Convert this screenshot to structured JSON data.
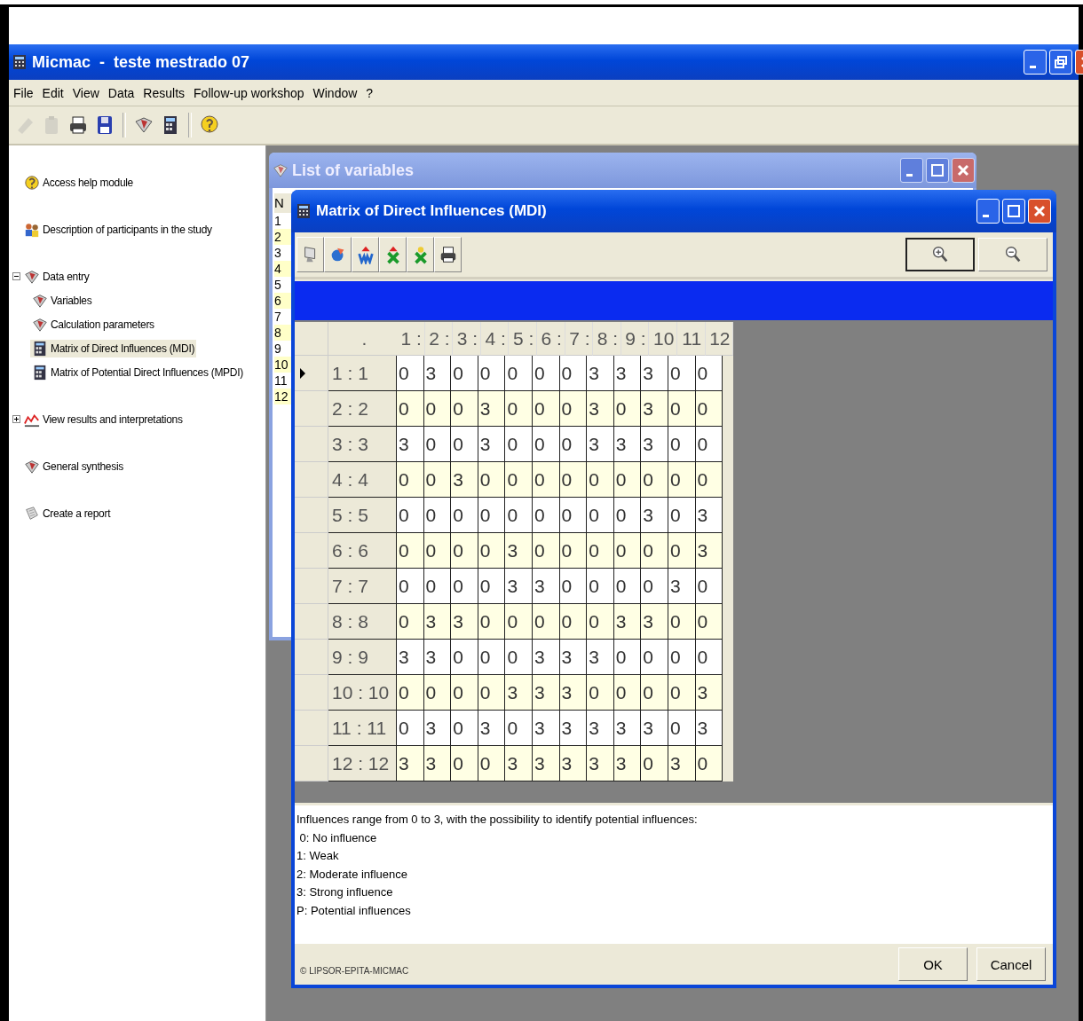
{
  "window": {
    "title": "Micmac  -  teste mestrado 07"
  },
  "menu": [
    "File",
    "Edit",
    "View",
    "Data",
    "Results",
    "Follow-up workshop",
    "Window",
    "?"
  ],
  "toolbar": [
    {
      "kind": "pencil",
      "disabled": true
    },
    {
      "kind": "clipboard",
      "disabled": true
    },
    {
      "kind": "printer",
      "disabled": false
    },
    {
      "kind": "disk",
      "disabled": false
    },
    {
      "kind": "separator"
    },
    {
      "kind": "book",
      "disabled": false
    },
    {
      "kind": "calculator",
      "disabled": false
    },
    {
      "kind": "separator"
    },
    {
      "kind": "help",
      "disabled": false
    }
  ],
  "tree": [
    {
      "label": "Access help module",
      "kind": "help",
      "selected": false
    },
    {
      "label": "Description of participants in the study",
      "kind": "people",
      "selected": false
    },
    {
      "label": "Data entry",
      "kind": "book",
      "selected": false,
      "expanded": true,
      "children": [
        {
          "label": "Variables",
          "kind": "book",
          "selected": false
        },
        {
          "label": "Calculation parameters",
          "kind": "book",
          "selected": false
        },
        {
          "label": "Matrix of Direct Influences (MDI)",
          "kind": "calculator",
          "selected": true
        },
        {
          "label": "Matrix of Potential Direct Influences (MPDI)",
          "kind": "calculator",
          "selected": false
        }
      ]
    },
    {
      "label": "View results and interpretations",
      "kind": "chart",
      "selected": false,
      "expanded": false
    },
    {
      "label": "General synthesis",
      "kind": "book",
      "selected": false
    },
    {
      "label": "Create a report",
      "kind": "report",
      "selected": false
    }
  ],
  "list_window": {
    "title": "List of variables",
    "header": "N",
    "numbers": [
      "1",
      "2",
      "3",
      "4",
      "5",
      "6",
      "7",
      "8",
      "9",
      "10",
      "11",
      "12"
    ]
  },
  "matrix_window": {
    "title": "Matrix of Direct Influences (MDI)",
    "toolbar": [
      {
        "kind": "monitor"
      },
      {
        "kind": "refresh"
      },
      {
        "kind": "w-arrow"
      },
      {
        "kind": "x-arrow"
      },
      {
        "kind": "x-star"
      },
      {
        "kind": "printer"
      }
    ],
    "zoom": [
      {
        "kind": "zoom-in",
        "pressed": true
      },
      {
        "kind": "zoom-out",
        "pressed": false
      }
    ],
    "corner": ".",
    "columns": [
      "1 :",
      "2 :",
      "3 :",
      "4 :",
      "5 :",
      "6 :",
      "7 :",
      "8 :",
      "9 :",
      "10",
      "11",
      "12"
    ],
    "rows": [
      {
        "label": "1 : 1",
        "selected": true,
        "values": [
          "0",
          "3",
          "0",
          "0",
          "0",
          "0",
          "0",
          "3",
          "3",
          "3",
          "0",
          "0"
        ]
      },
      {
        "label": "2 : 2",
        "selected": false,
        "values": [
          "0",
          "0",
          "0",
          "3",
          "0",
          "0",
          "0",
          "3",
          "0",
          "3",
          "0",
          "0"
        ]
      },
      {
        "label": "3 : 3",
        "selected": false,
        "values": [
          "3",
          "0",
          "0",
          "3",
          "0",
          "0",
          "0",
          "3",
          "3",
          "3",
          "0",
          "0"
        ]
      },
      {
        "label": "4 : 4",
        "selected": false,
        "values": [
          "0",
          "0",
          "3",
          "0",
          "0",
          "0",
          "0",
          "0",
          "0",
          "0",
          "0",
          "0"
        ]
      },
      {
        "label": "5 : 5",
        "selected": false,
        "values": [
          "0",
          "0",
          "0",
          "0",
          "0",
          "0",
          "0",
          "0",
          "0",
          "3",
          "0",
          "3"
        ]
      },
      {
        "label": "6 : 6",
        "selected": false,
        "values": [
          "0",
          "0",
          "0",
          "0",
          "3",
          "0",
          "0",
          "0",
          "0",
          "0",
          "0",
          "3"
        ]
      },
      {
        "label": "7 : 7",
        "selected": false,
        "values": [
          "0",
          "0",
          "0",
          "0",
          "3",
          "3",
          "0",
          "0",
          "0",
          "0",
          "3",
          "0"
        ]
      },
      {
        "label": "8 : 8",
        "selected": false,
        "values": [
          "0",
          "3",
          "3",
          "0",
          "0",
          "0",
          "0",
          "0",
          "3",
          "3",
          "0",
          "0"
        ]
      },
      {
        "label": "9 : 9",
        "selected": false,
        "values": [
          "3",
          "3",
          "0",
          "0",
          "0",
          "3",
          "3",
          "3",
          "0",
          "0",
          "0",
          "0"
        ]
      },
      {
        "label": "10 : 10",
        "selected": false,
        "values": [
          "0",
          "0",
          "0",
          "0",
          "3",
          "3",
          "3",
          "0",
          "0",
          "0",
          "0",
          "3"
        ]
      },
      {
        "label": "11 : 11",
        "selected": false,
        "values": [
          "0",
          "3",
          "0",
          "3",
          "0",
          "3",
          "3",
          "3",
          "3",
          "3",
          "0",
          "3"
        ]
      },
      {
        "label": "12 : 12",
        "selected": false,
        "values": [
          "3",
          "3",
          "0",
          "0",
          "3",
          "3",
          "3",
          "3",
          "3",
          "0",
          "3",
          "0"
        ]
      }
    ],
    "notes": [
      "Influences range from 0 to 3, with the possibility to identify potential influences:",
      " 0: No influence",
      "1: Weak",
      "2: Moderate influence",
      "3: Strong influence",
      "P: Potential influences"
    ],
    "copyright": "© LIPSOR-EPITA-MICMAC",
    "buttons": [
      "OK",
      "Cancel"
    ]
  }
}
